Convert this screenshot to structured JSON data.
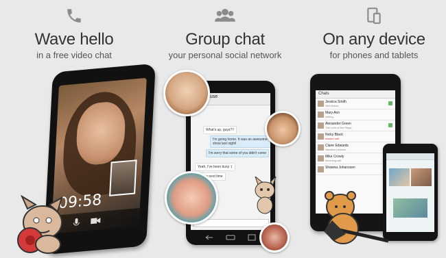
{
  "panels": [
    {
      "icon": "phone-icon",
      "title": "Wave hello",
      "subtitle": "in a free video chat"
    },
    {
      "icon": "group-icon",
      "title": "Group chat",
      "subtitle": "your personal social network"
    },
    {
      "icon": "devices-icon",
      "title": "On any device",
      "subtitle": "for phones and tablets"
    }
  ],
  "video_call": {
    "timer": "09:58"
  },
  "group_chat": {
    "room_title": "Tree house",
    "messages": [
      "What's up, guys?!!",
      "I'm going home. It was an awesome show last night!",
      "I'm sorry that some of you didn't come",
      "Yeah, I've been busy :(",
      "Maybe next time"
    ]
  },
  "tablet": {
    "header": "Chats",
    "chats": [
      {
        "name": "Jessica Smith",
        "status": "Wet ribbon"
      },
      {
        "name": "Mary Ann",
        "status": "writing..."
      },
      {
        "name": "Alexander Green",
        "status": "The Lord of the Rings"
      },
      {
        "name": "Nicky Black",
        "status": "missed call"
      },
      {
        "name": "Claire Edwards",
        "status": "Vacation pictures"
      },
      {
        "name": "Mike Crowly",
        "status": "incoming call"
      },
      {
        "name": "Shawna Johanssen",
        "status": ""
      }
    ]
  },
  "colors": {
    "background": "#e9e9e9",
    "title": "#333333",
    "accent_blue": "#33b5e5"
  }
}
